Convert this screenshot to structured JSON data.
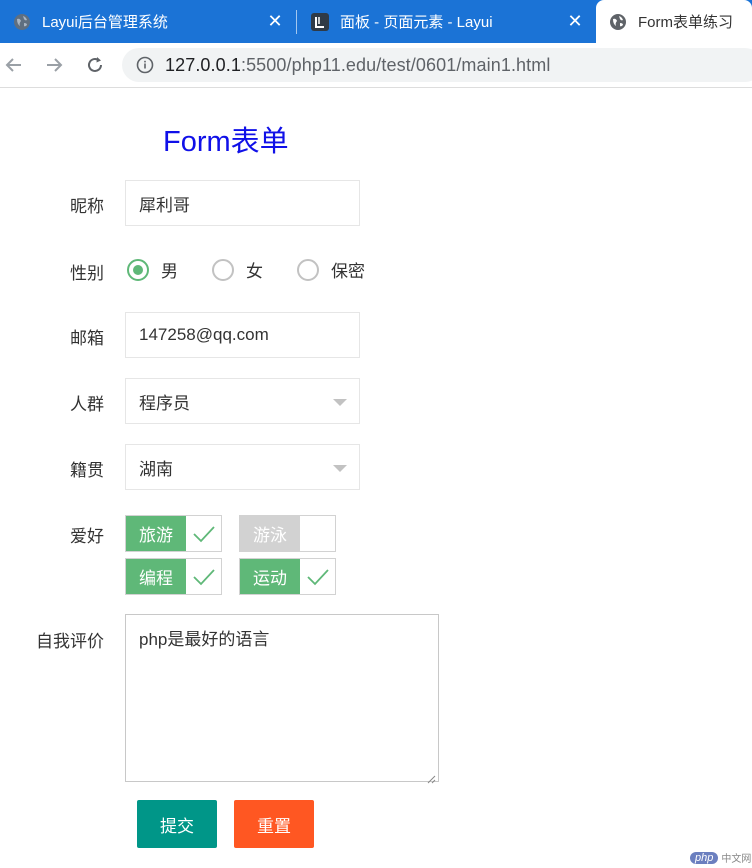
{
  "browser": {
    "tabs": [
      {
        "title": "Layui后台管理系统",
        "icon": "globe-icon",
        "active": false
      },
      {
        "title": "面板 - 页面元素 - Layui",
        "icon": "layui-logo-icon",
        "active": false
      },
      {
        "title": "Form表单练习",
        "icon": "globe-icon",
        "active": true
      }
    ],
    "url_host": "127.0.0.1",
    "url_rest": ":5500/php11.edu/test/0601/main1.html"
  },
  "form": {
    "title": "Form表单",
    "nickname": {
      "label": "昵称",
      "value": "犀利哥"
    },
    "gender": {
      "label": "性别",
      "options": [
        "男",
        "女",
        "保密"
      ],
      "selected": "男"
    },
    "email": {
      "label": "邮箱",
      "value": "147258@qq.com"
    },
    "crowd": {
      "label": "人群",
      "value": "程序员"
    },
    "origin": {
      "label": "籍贯",
      "value": "湖南"
    },
    "hobbies": {
      "label": "爱好",
      "items": [
        {
          "label": "旅游",
          "checked": true
        },
        {
          "label": "游泳",
          "checked": false
        },
        {
          "label": "编程",
          "checked": true
        },
        {
          "label": "运动",
          "checked": true
        }
      ]
    },
    "self_eval": {
      "label": "自我评价",
      "value": "php是最好的语言"
    },
    "submit_label": "提交",
    "reset_label": "重置"
  },
  "colors": {
    "tabbar": "#1b73d6",
    "title": "#1010e8",
    "accent_green": "#5fb878",
    "submit": "#009688",
    "reset": "#ff5722"
  },
  "watermark": {
    "brand": "php",
    "text": "中文网"
  }
}
